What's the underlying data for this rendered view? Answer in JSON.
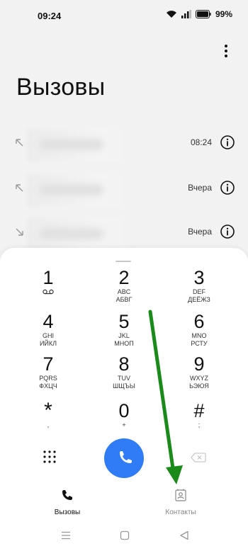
{
  "status_bar": {
    "time": "09:24",
    "battery": "99%"
  },
  "header": {
    "title": "Вызовы"
  },
  "calls": [
    {
      "direction": "outgoing",
      "time": "08:24"
    },
    {
      "direction": "outgoing",
      "time": "Вчера"
    },
    {
      "direction": "incoming",
      "time": "Вчера"
    }
  ],
  "keypad": [
    {
      "digit": "1",
      "latin": "",
      "cyrillic": "",
      "voicemail": true
    },
    {
      "digit": "2",
      "latin": "ABC",
      "cyrillic": "АБВГ"
    },
    {
      "digit": "3",
      "latin": "DEF",
      "cyrillic": "ДЕЁЖЗ"
    },
    {
      "digit": "4",
      "latin": "GHI",
      "cyrillic": "ИЙКЛ"
    },
    {
      "digit": "5",
      "latin": "JKL",
      "cyrillic": "МНОП"
    },
    {
      "digit": "6",
      "latin": "MNO",
      "cyrillic": "РСТУ"
    },
    {
      "digit": "7",
      "latin": "PQRS",
      "cyrillic": "ФХЦЧ"
    },
    {
      "digit": "8",
      "latin": "TUV",
      "cyrillic": "ШЩЪЫ"
    },
    {
      "digit": "9",
      "latin": "WXYZ",
      "cyrillic": "ЬЭЮЯ"
    },
    {
      "digit": "*",
      "latin": ",",
      "cyrillic": ""
    },
    {
      "digit": "0",
      "latin": "+",
      "cyrillic": ""
    },
    {
      "digit": "#",
      "latin": ";",
      "cyrillic": ""
    }
  ],
  "tabs": {
    "calls_label": "Вызовы",
    "contacts_label": "Контакты"
  },
  "colors": {
    "call_button": "#2f7cf6",
    "annotation_arrow": "#1a8a1a"
  }
}
